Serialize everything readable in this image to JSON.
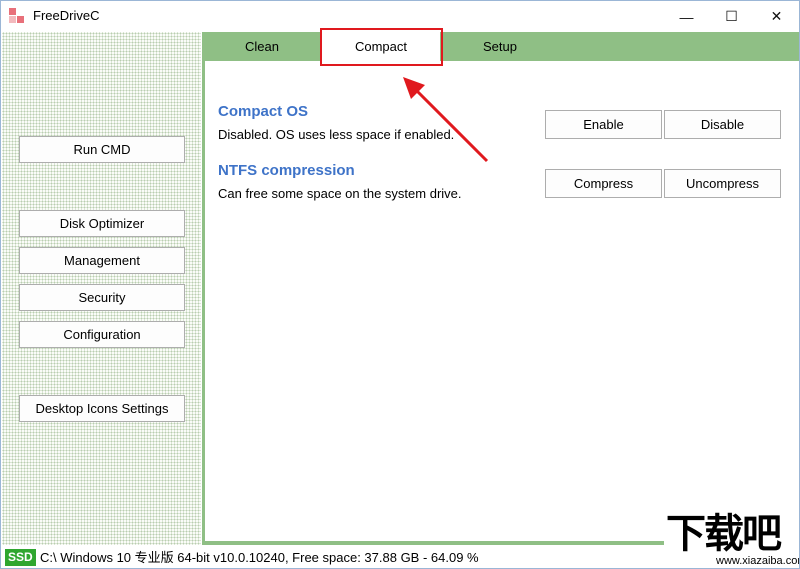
{
  "window": {
    "title": "FreeDriveC"
  },
  "title_controls": {
    "minimize": "—",
    "maximize": "☐",
    "close": "✕"
  },
  "sidebar": {
    "buttons": [
      {
        "label": "Run CMD"
      },
      {
        "label": "Disk Optimizer"
      },
      {
        "label": "Management"
      },
      {
        "label": "Security"
      },
      {
        "label": "Configuration"
      },
      {
        "label": "Desktop Icons Settings"
      }
    ]
  },
  "tabs": [
    {
      "label": "Clean"
    },
    {
      "label": "Compact",
      "active": true
    },
    {
      "label": "Setup"
    }
  ],
  "compact_os": {
    "title": "Compact OS",
    "description": "Disabled. OS uses less space if enabled.",
    "enable_label": "Enable",
    "disable_label": "Disable"
  },
  "ntfs": {
    "title": "NTFS compression",
    "description": "Can free some space on the system drive.",
    "compress_label": "Compress",
    "uncompress_label": "Uncompress"
  },
  "statusbar": {
    "badge": "SSD",
    "text": "C:\\ Windows 10 专业版 64-bit v10.0.10240, Free space: 37.88 GB - 64.09 %"
  },
  "watermark": {
    "main": "下载吧",
    "sub": "www.xiazaiba.com"
  },
  "colors": {
    "tab_bar": "#8fbf85",
    "accent_title": "#3e73c8",
    "highlight": "#e0191e",
    "ssd_badge": "#2fa62f"
  }
}
